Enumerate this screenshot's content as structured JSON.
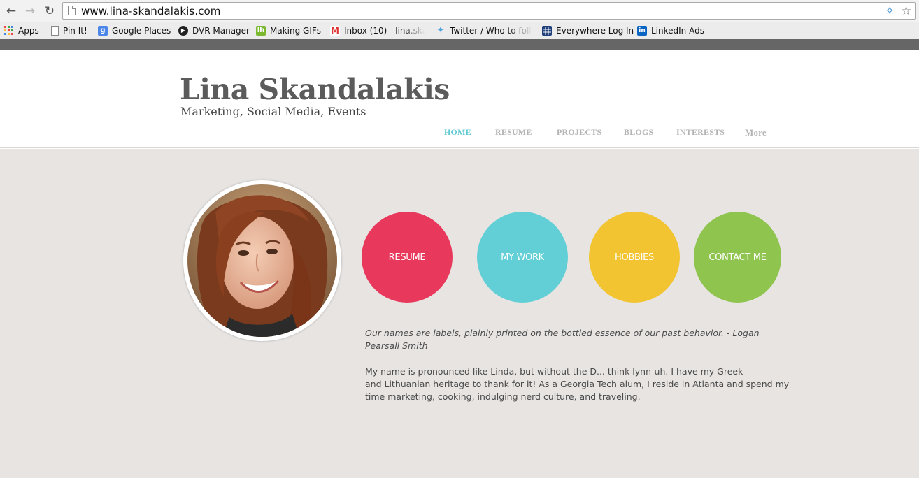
{
  "browser": {
    "url": "www.lina-skandalakis.com",
    "nav_icons": {
      "back": "back-arrow-icon",
      "forward": "forward-arrow-icon",
      "reload": "reload-icon"
    },
    "bookmarks": [
      {
        "label": "Apps",
        "icon": "apps-grid-icon"
      },
      {
        "label": "Pin It!",
        "icon": "page-icon"
      },
      {
        "label": "Google Places",
        "icon": "google-icon"
      },
      {
        "label": "DVR Manager",
        "icon": "play-icon"
      },
      {
        "label": "Making GIFs",
        "icon": "lh-icon"
      },
      {
        "label": "Inbox (10) - lina.ska",
        "icon": "gmail-icon"
      },
      {
        "label": "Twitter / Who to foll",
        "icon": "twitter-bird-icon"
      },
      {
        "label": "Everywhere Log In",
        "icon": "grid-icon"
      },
      {
        "label": "LinkedIn Ads",
        "icon": "linkedin-icon"
      }
    ]
  },
  "site": {
    "title": "Lina Skandalakis",
    "tagline": "Marketing, Social Media, Events",
    "nav": [
      {
        "label": "HOME",
        "active": true
      },
      {
        "label": "RESUME",
        "active": false
      },
      {
        "label": "PROJECTS",
        "active": false
      },
      {
        "label": "BLOGS",
        "active": false
      },
      {
        "label": "INTERESTS",
        "active": false
      },
      {
        "label": "More",
        "active": false
      }
    ]
  },
  "main": {
    "circles": [
      {
        "label": "RESUME",
        "color": "#e8385b"
      },
      {
        "label": "MY WORK",
        "color": "#62cfd6"
      },
      {
        "label": "HOBBIES",
        "color": "#f2c431"
      },
      {
        "label": "CONTACT ME",
        "color": "#8fc44f"
      }
    ],
    "quote": "Our names are labels, plainly printed on the bottled essence of our past behavior. - Logan Pearsall Smith",
    "bio": [
      "My name is pronounced like Linda, but without the D... think lynn-uh. I have my Greek",
      "and Lithuanian heritage to thank for it! As a Georgia Tech alum, I reside in Atlanta and spend my",
      "time marketing, cooking, indulging nerd culture, and traveling."
    ]
  },
  "colors": {
    "nav_active": "#5fc9d2",
    "nav_inactive": "#b4b4b4",
    "content_background": "#e7e4e2",
    "header_strip": "#666666"
  }
}
